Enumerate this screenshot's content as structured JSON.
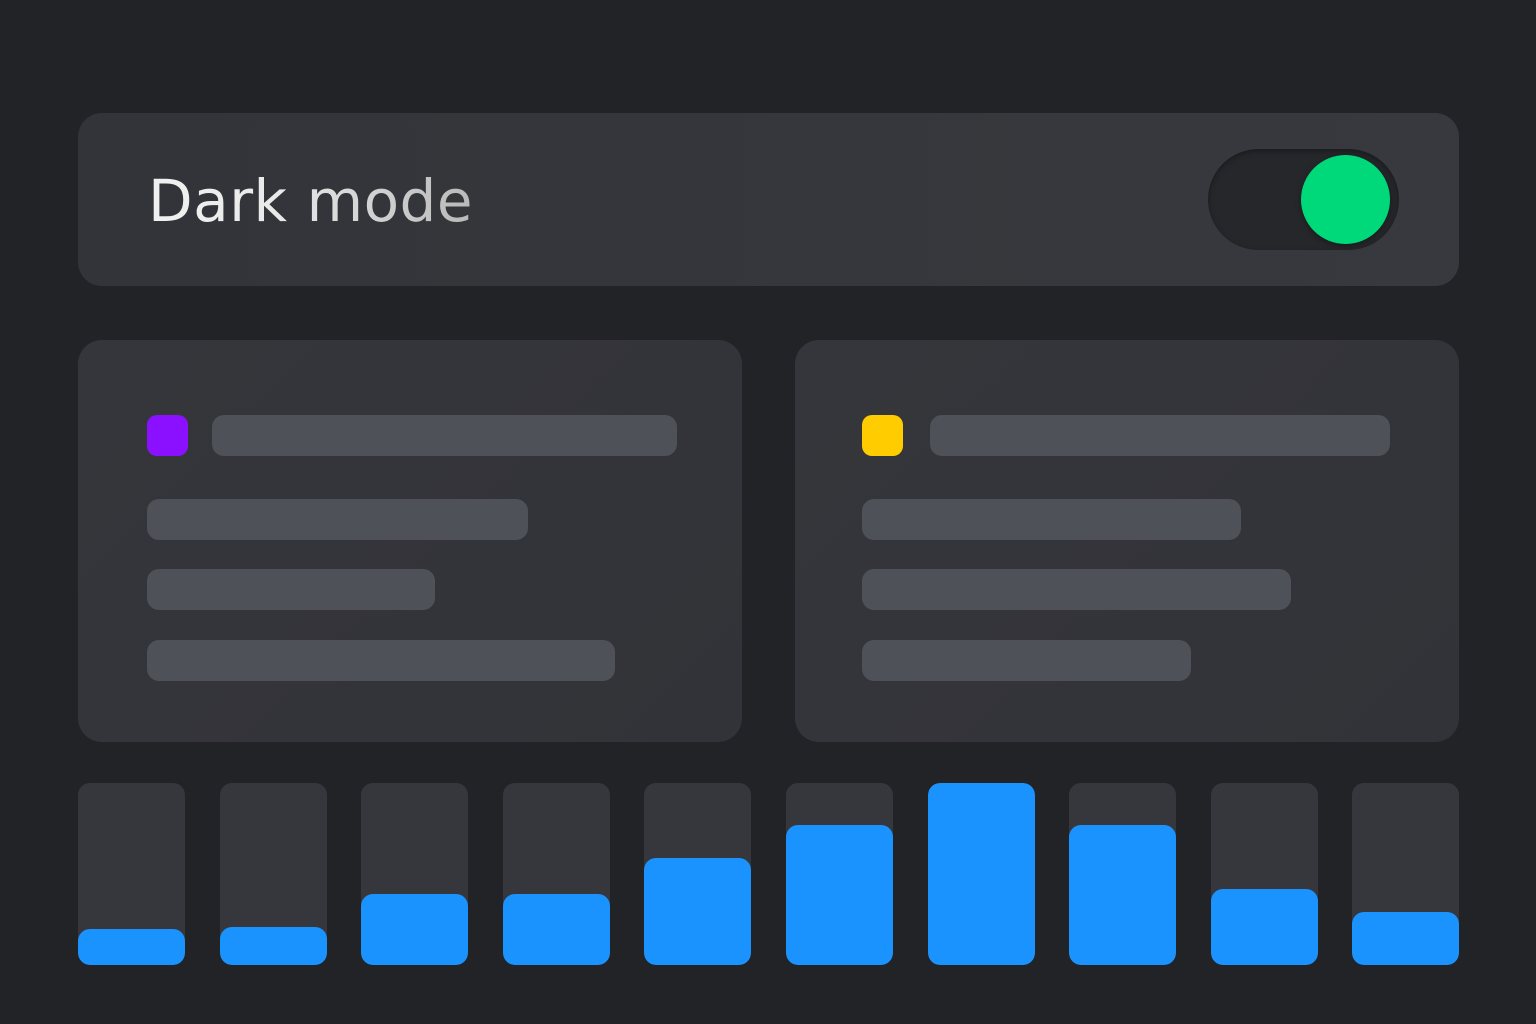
{
  "header": {
    "title": "Dark mode",
    "toggle": {
      "on": true,
      "knob_color": "#00d97a",
      "track_color": "#26272b"
    }
  },
  "cards": [
    {
      "accent_color": "#8a10ff"
    },
    {
      "accent_color": "#ffcc00"
    }
  ],
  "bar_levels": [
    0.2,
    0.21,
    0.39,
    0.39,
    0.59,
    0.77,
    1.0,
    0.77,
    0.42,
    0.29
  ],
  "colors": {
    "background": "#222327",
    "bar_fill": "#1b93ff",
    "bar_track": "#35373c",
    "skeleton": "#4e5157"
  }
}
